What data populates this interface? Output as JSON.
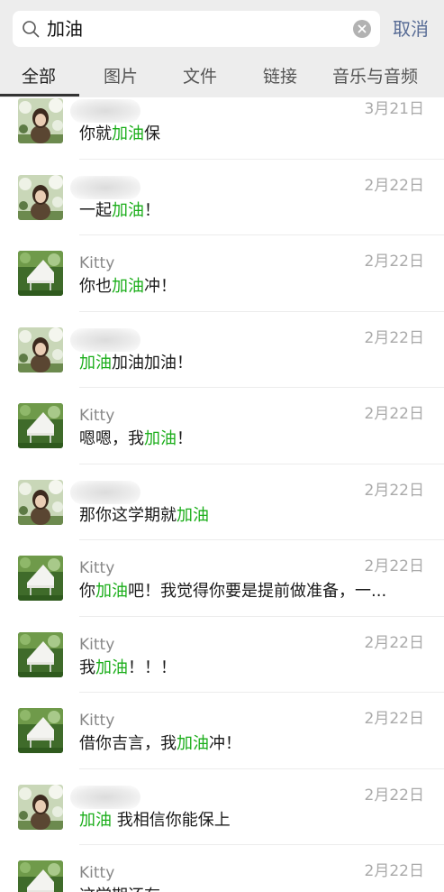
{
  "search": {
    "query": "加油",
    "cancel_label": "取消"
  },
  "tabs": [
    {
      "label": "全部"
    },
    {
      "label": "图片"
    },
    {
      "label": "文件"
    },
    {
      "label": "链接"
    },
    {
      "label": "音乐与音频"
    }
  ],
  "colors": {
    "highlight": "#1aad19",
    "link": "#576b95"
  },
  "results": [
    {
      "avatar": "girl",
      "name": "",
      "date": "3月21日",
      "parts": [
        [
          "你就",
          0
        ],
        [
          "加油",
          1
        ],
        [
          "保",
          0
        ]
      ]
    },
    {
      "avatar": "girl",
      "name": "",
      "date": "2月22日",
      "parts": [
        [
          "一起",
          0
        ],
        [
          "加油",
          1
        ],
        [
          "！",
          0
        ]
      ]
    },
    {
      "avatar": "piano",
      "name": "Kitty",
      "date": "2月22日",
      "parts": [
        [
          "你也",
          0
        ],
        [
          "加油",
          1
        ],
        [
          "冲！",
          0
        ]
      ]
    },
    {
      "avatar": "girl",
      "name": "",
      "date": "2月22日",
      "parts": [
        [
          "加油",
          1
        ],
        [
          "加油加油！",
          0
        ]
      ]
    },
    {
      "avatar": "piano",
      "name": "Kitty",
      "date": "2月22日",
      "parts": [
        [
          "嗯嗯，我",
          0
        ],
        [
          "加油",
          1
        ],
        [
          "！",
          0
        ]
      ]
    },
    {
      "avatar": "girl",
      "name": "",
      "date": "2月22日",
      "parts": [
        [
          "那你这学期就",
          0
        ],
        [
          "加油",
          1
        ]
      ]
    },
    {
      "avatar": "piano",
      "name": "Kitty",
      "date": "2月22日",
      "parts": [
        [
          "你",
          0
        ],
        [
          "加油",
          1
        ],
        [
          "吧！我觉得你要是提前做准备，一...",
          0
        ]
      ]
    },
    {
      "avatar": "piano",
      "name": "Kitty",
      "date": "2月22日",
      "parts": [
        [
          "我",
          0
        ],
        [
          "加油",
          1
        ],
        [
          "！！！",
          0
        ]
      ]
    },
    {
      "avatar": "piano",
      "name": "Kitty",
      "date": "2月22日",
      "parts": [
        [
          "借你吉言，我",
          0
        ],
        [
          "加油",
          1
        ],
        [
          "冲！",
          0
        ]
      ]
    },
    {
      "avatar": "girl",
      "name": "",
      "date": "2月22日",
      "parts": [
        [
          "加油",
          1
        ],
        [
          " 我相信你能保上",
          0
        ]
      ]
    },
    {
      "avatar": "piano",
      "name": "Kitty",
      "date": "2月22日",
      "parts": [
        [
          "这学期还有",
          0
        ]
      ]
    }
  ]
}
